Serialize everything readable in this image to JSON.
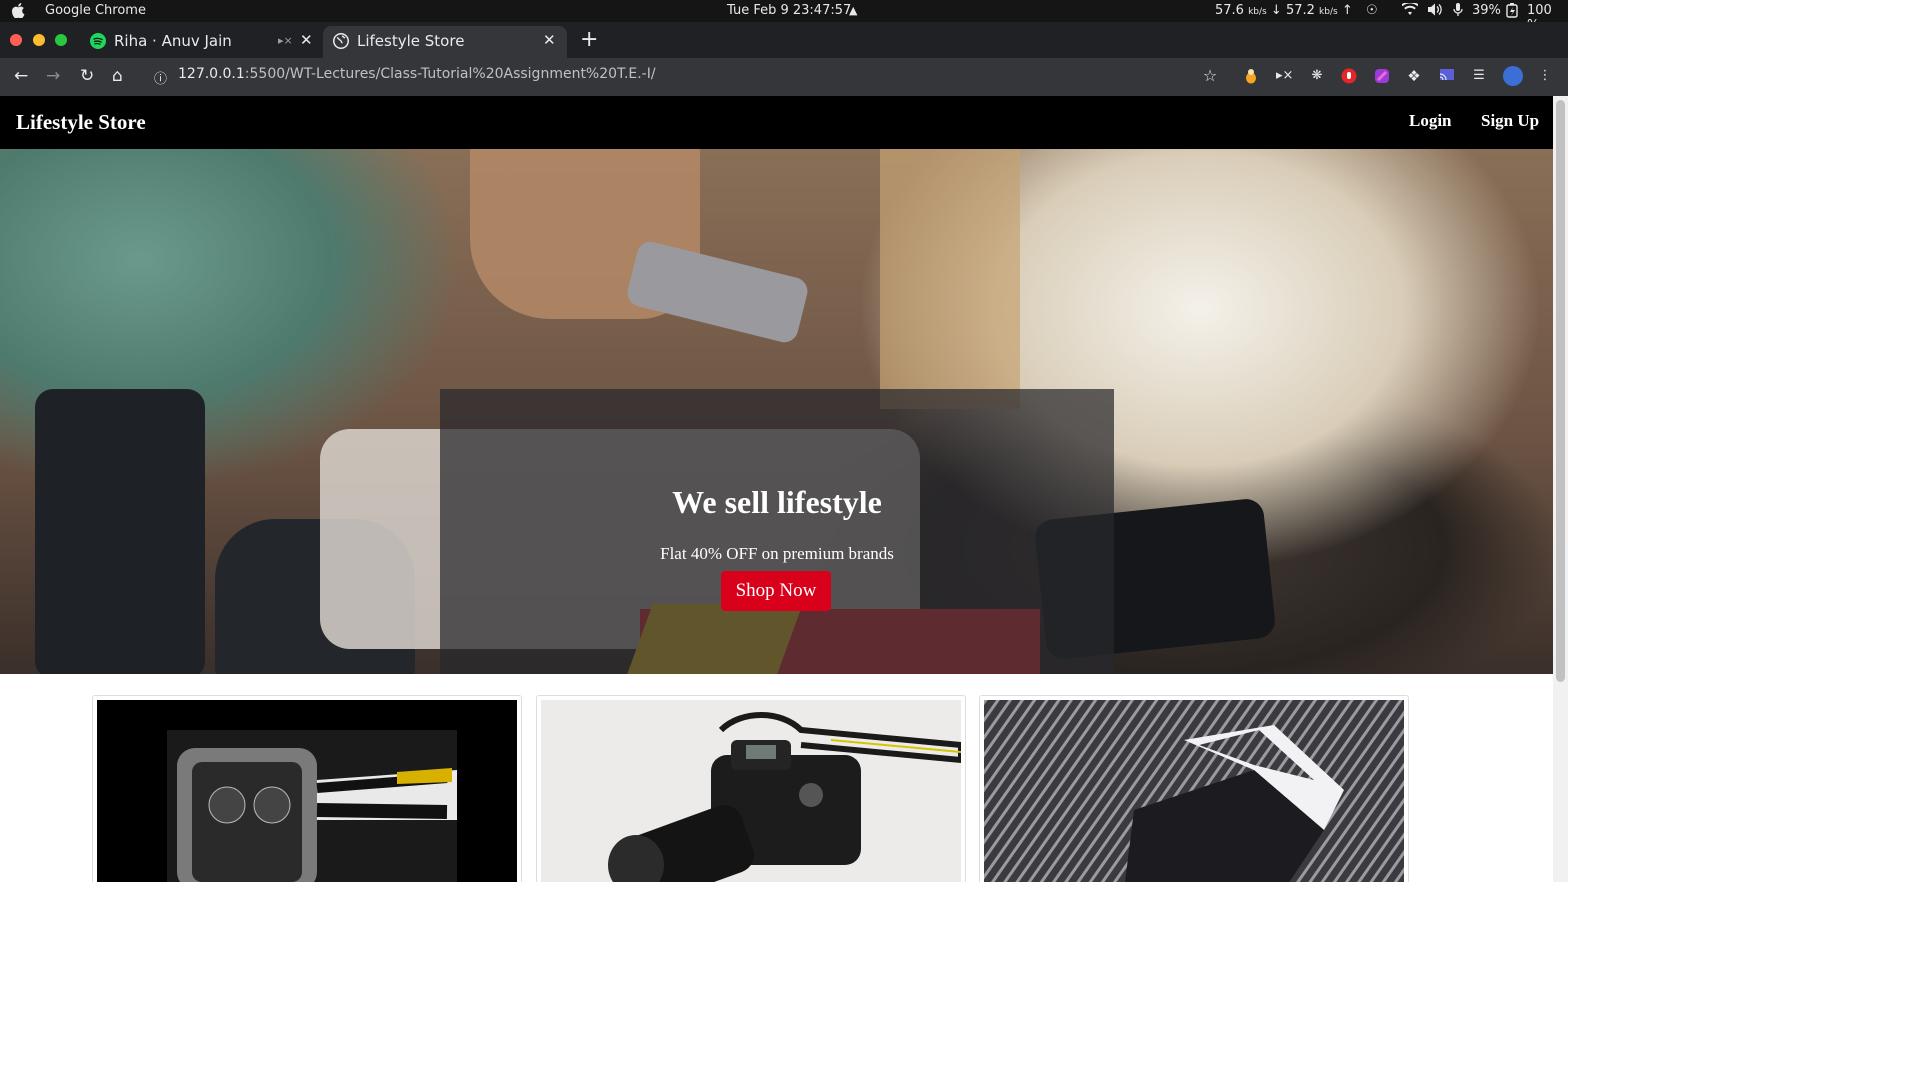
{
  "os": {
    "app_name": "Google Chrome",
    "clock": "Tue Feb 9  23:47:57",
    "net_down": "57.6",
    "net_down_unit": "kb/s",
    "net_up": "57.2",
    "net_up_unit": "kb/s",
    "volume_percent": "39%",
    "battery": "100 %"
  },
  "browser": {
    "tabs": [
      {
        "title": "Riha · Anuv Jain",
        "active": false
      },
      {
        "title": "Lifestyle Store",
        "active": true
      }
    ],
    "url_host": "127.0.0.1",
    "url_rest": ":5500/WT-Lectures/Class-Tutorial%20Assignment%20T.E.-I/"
  },
  "site": {
    "brand": "Lifestyle Store",
    "nav": {
      "login": "Login",
      "signup": "Sign Up"
    },
    "banner": {
      "heading": "We sell lifestyle",
      "subtext": "Flat 40% OFF on premium brands",
      "cta": "Shop Now"
    },
    "products": [
      {
        "image": "watch"
      },
      {
        "image": "camera"
      },
      {
        "image": "shirt"
      }
    ]
  },
  "colors": {
    "navbar": "#000000",
    "cta": "#d9001b",
    "chrome_frame": "#202124",
    "chrome_toolbar": "#35363a"
  }
}
